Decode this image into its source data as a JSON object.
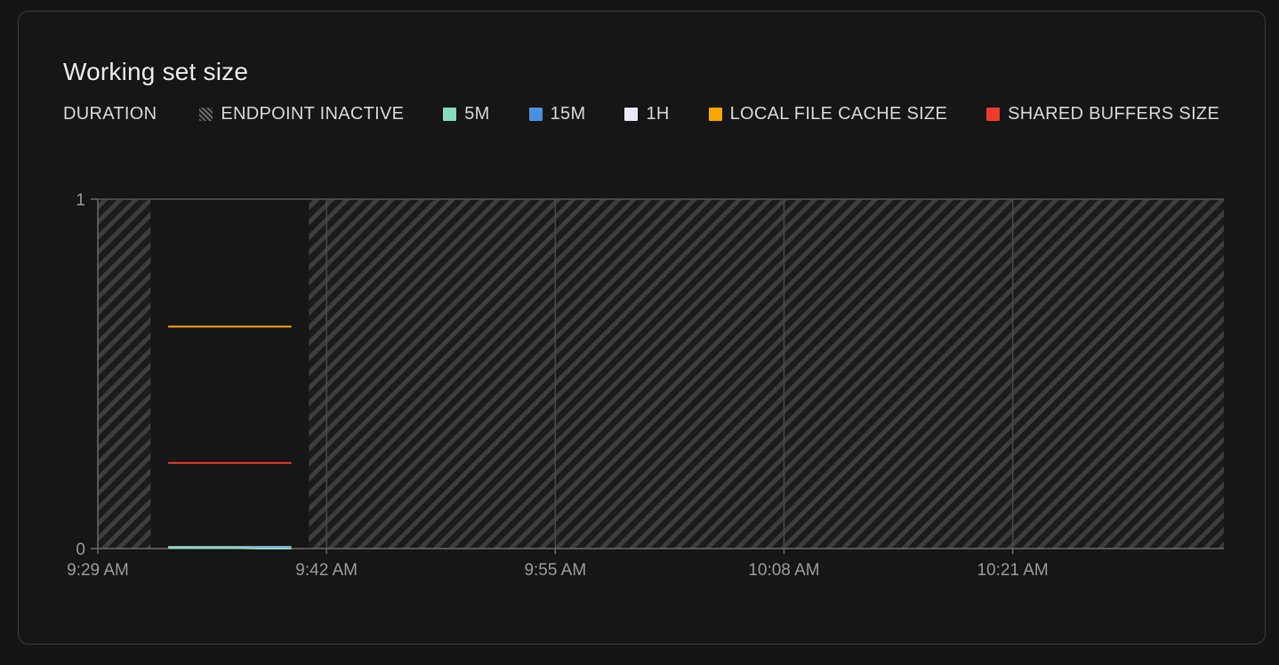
{
  "chart_data": {
    "type": "line",
    "title": "Working set size",
    "legend_label": "DURATION",
    "legend_placement": "top-left",
    "legend": [
      {
        "name": "ENDPOINT INACTIVE",
        "kind": "hatch",
        "color": "#5a5a5a"
      },
      {
        "name": "5M",
        "kind": "line",
        "color": "#86dcbf"
      },
      {
        "name": "15M",
        "kind": "line",
        "color": "#4a90e2"
      },
      {
        "name": "1H",
        "kind": "line",
        "color": "#ece8ff"
      },
      {
        "name": "LOCAL FILE CACHE SIZE",
        "kind": "line",
        "color": "#ffa500"
      },
      {
        "name": "SHARED BUFFERS SIZE",
        "kind": "line",
        "color": "#f03a2a"
      }
    ],
    "x_axis": {
      "unit": "minutes",
      "range": [
        "9:29 AM",
        "10:33 AM"
      ],
      "ticks": [
        {
          "label": "9:29 AM",
          "value": "9:29 AM"
        },
        {
          "label": "9:42 AM",
          "value": "9:42 AM"
        },
        {
          "label": "9:55 AM",
          "value": "9:55 AM"
        },
        {
          "label": "10:08 AM",
          "value": "10:08 AM"
        },
        {
          "label": "10:21 AM",
          "value": "10:21 AM"
        }
      ]
    },
    "y_axis": {
      "range": [
        0,
        1
      ],
      "ticks": [
        {
          "label": "0",
          "value": 0
        },
        {
          "label": "1",
          "value": 1
        }
      ]
    },
    "grid": "vertical",
    "inactive_periods": [
      {
        "start": "9:29 AM",
        "end": "9:32 AM"
      },
      {
        "start": "9:41 AM",
        "end": "10:33 AM"
      }
    ],
    "series": [
      {
        "name": "LOCAL FILE CACHE SIZE",
        "color": "#ffa500",
        "points": [
          [
            "9:33 AM",
            0.635
          ],
          [
            "9:40 AM",
            0.635
          ]
        ]
      },
      {
        "name": "SHARED BUFFERS SIZE",
        "color": "#f03a2a",
        "points": [
          [
            "9:33 AM",
            0.245
          ],
          [
            "9:40 AM",
            0.245
          ]
        ]
      },
      {
        "name": "1H",
        "color": "#ece8ff",
        "points": [
          [
            "9:33 AM",
            0.004
          ],
          [
            "9:40 AM",
            0.004
          ]
        ]
      },
      {
        "name": "15M",
        "color": "#4a90e2",
        "points": [
          [
            "9:33 AM",
            0.002
          ],
          [
            "9:40 AM",
            0.002
          ]
        ]
      },
      {
        "name": "5M",
        "color": "#86dcbf",
        "points": [
          [
            "9:33 AM",
            0.002
          ],
          [
            "9:37 AM",
            0.0015
          ],
          [
            "9:38 AM",
            0.0
          ],
          [
            "9:40 AM",
            0.0
          ]
        ]
      }
    ]
  }
}
